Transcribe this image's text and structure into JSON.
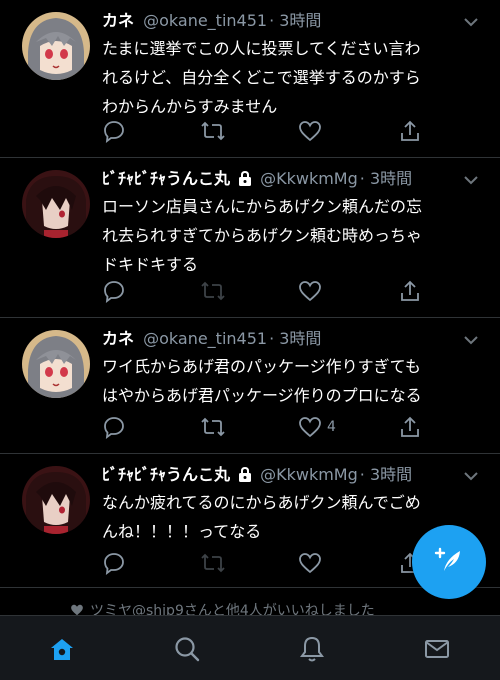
{
  "colors": {
    "accent": "#1da1f2",
    "muted": "#8b98a5",
    "background": "#000000",
    "tabbar": "#15181c"
  },
  "tweets": [
    {
      "name": "カネ",
      "handle": "@okane_tin451",
      "time": "· 3時間",
      "protected": false,
      "avatar": "gray-hair-anime-avatar",
      "lines": [
        "たまに選挙でこの人に投票してください言わ",
        "れるけど、自分全くどこで選挙するのかすら",
        "わからんからすみません"
      ],
      "like_count": ""
    },
    {
      "name": "ﾋﾞﾁｬﾋﾞﾁｬうんこ丸",
      "handle": "@KkwkmMg",
      "time": "· 3時間",
      "protected": true,
      "avatar": "dark-hair-anime-avatar",
      "lines": [
        "ローソン店員さんにからあげクン頼んだの忘",
        "れ去られすぎてからあげクン頼む時めっちゃ",
        "ドキドキする"
      ],
      "like_count": ""
    },
    {
      "name": "カネ",
      "handle": "@okane_tin451",
      "time": "· 3時間",
      "protected": false,
      "avatar": "gray-hair-anime-avatar",
      "lines": [
        "ワイ氏からあげ君のパッケージ作りすぎても",
        "はやからあげ君パッケージ作りのプロになる"
      ],
      "like_count": "4"
    },
    {
      "name": "ﾋﾞﾁｬﾋﾞﾁｬうんこ丸",
      "handle": "@KkwkmMg",
      "time": "· 3時間",
      "protected": true,
      "avatar": "dark-hair-anime-avatar",
      "lines": [
        "なんか疲れてるのにからあげクン頼んでごめ",
        "んね！！！！ってなる"
      ],
      "like_count": ""
    }
  ],
  "activity_note": "ツミヤ@ship9さんと他4人がいいねしました",
  "tabs": [
    "home",
    "search",
    "notifications",
    "messages"
  ],
  "active_tab": "home"
}
